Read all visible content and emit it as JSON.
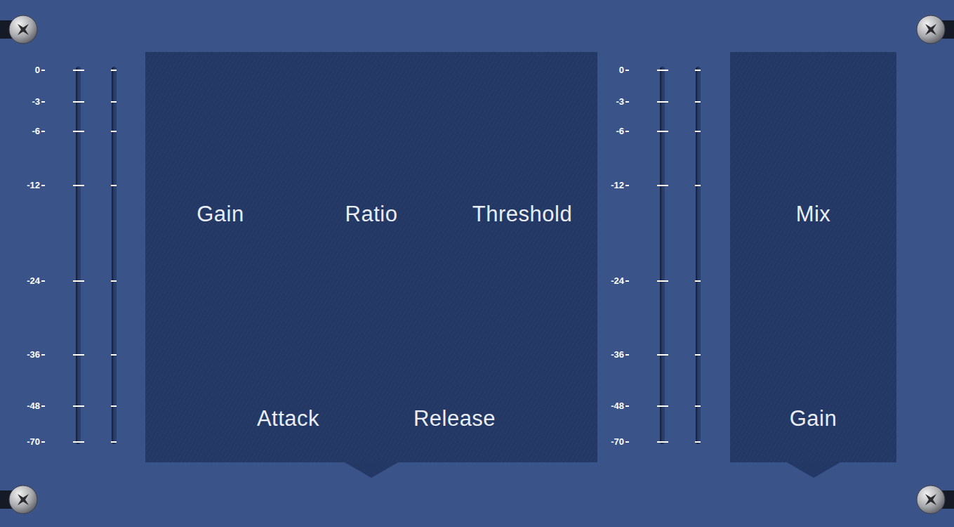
{
  "plugin": {
    "meters": [
      {
        "name": "input",
        "scale": [
          "0",
          "-3",
          "-6",
          "-12",
          "-24",
          "-36",
          "-48",
          "-70"
        ],
        "channels": [
          {
            "level": 0
          },
          {
            "level": 0
          }
        ]
      },
      {
        "name": "output",
        "scale": [
          "0",
          "-3",
          "-6",
          "-12",
          "-24",
          "-36",
          "-48",
          "-70"
        ],
        "channels": [
          {
            "level": 0
          },
          {
            "level": 0
          }
        ]
      }
    ],
    "main_panel": {
      "top_controls": [
        {
          "label": "Gain"
        },
        {
          "label": "Ratio"
        },
        {
          "label": "Threshold"
        }
      ],
      "bottom_controls": [
        {
          "label": "Attack"
        },
        {
          "label": "Release"
        }
      ]
    },
    "side_panel": {
      "top_controls": [
        {
          "label": "Mix"
        }
      ],
      "bottom_controls": [
        {
          "label": "Gain"
        }
      ]
    }
  }
}
